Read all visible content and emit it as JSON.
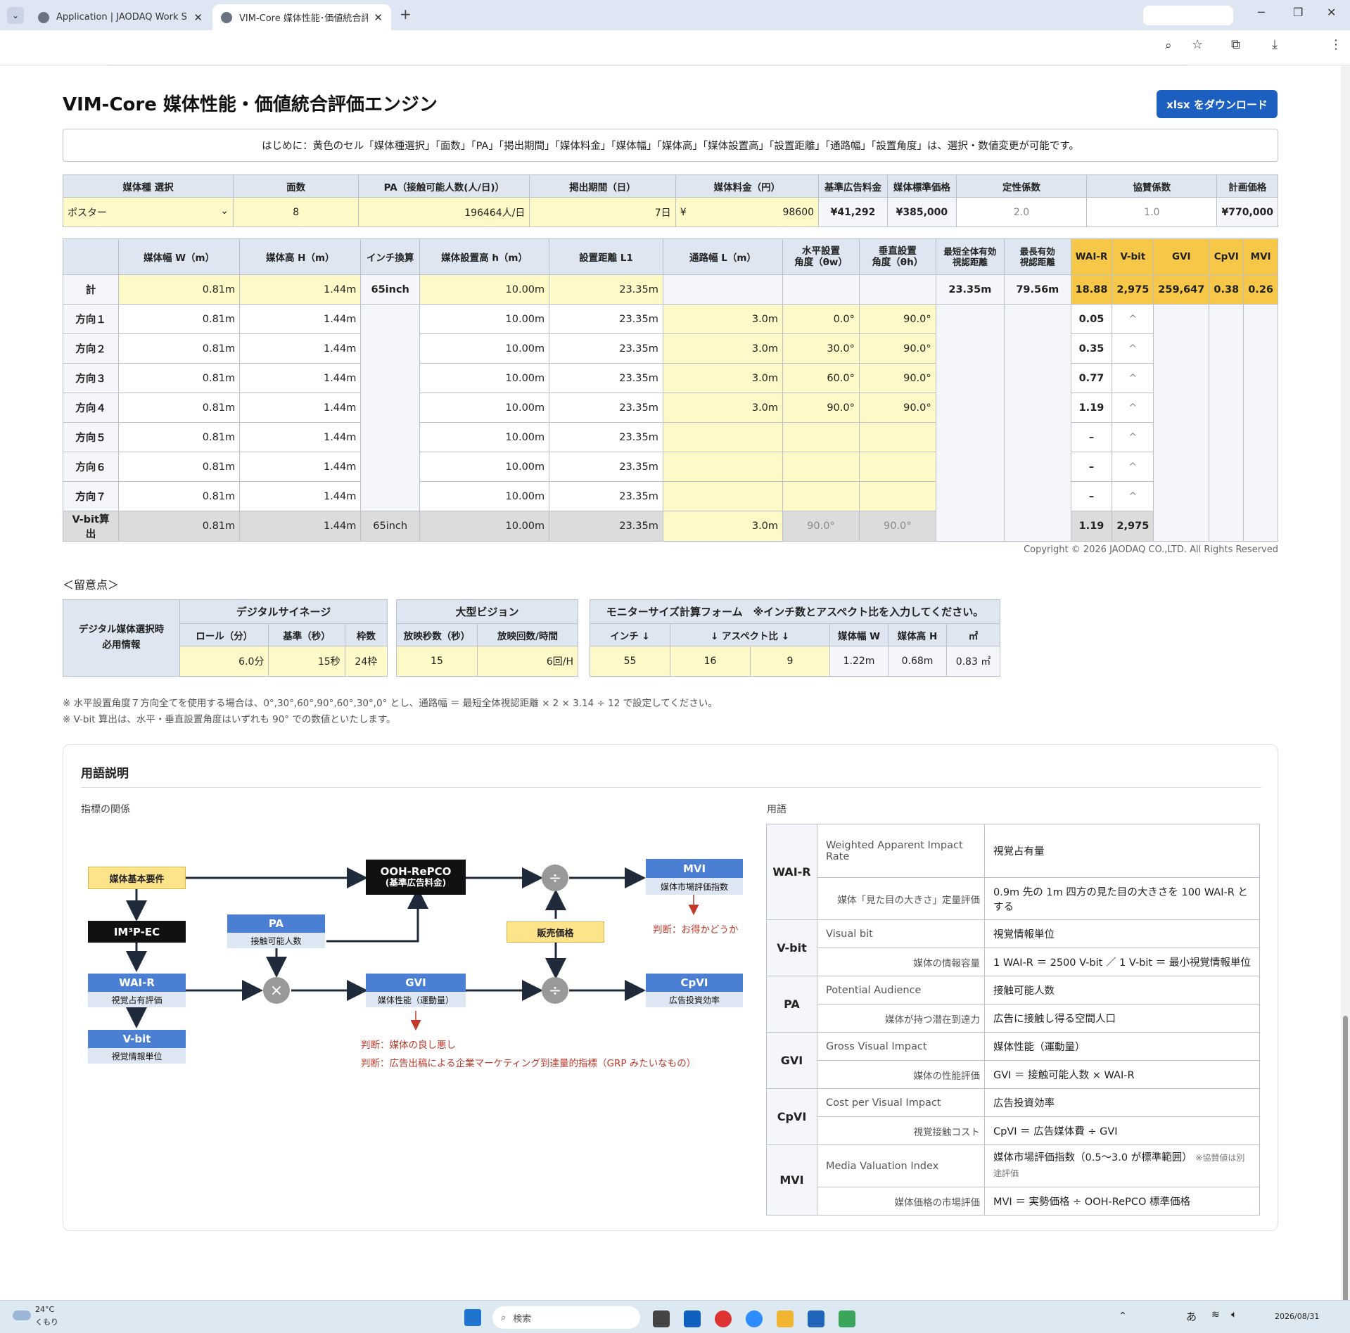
{
  "browser": {
    "tabs": [
      {
        "title": "Application | JAODAQ Work Space",
        "active": false
      },
      {
        "title": "VIM-Core 媒体性能･価値統合評価",
        "active": true
      }
    ],
    "new_tab": "+"
  },
  "page": {
    "title": "VIM-Core 媒体性能・価値統合評価エンジン",
    "download_label": "xlsx をダウンロード",
    "intro": "はじめに：黄色のセル「媒体種選択」「面数」「PA」「掲出期間」「媒体料金」「媒体幅」「媒体高」「媒体設置高」「設置距離」「通路幅」「設置角度」は、選択・数値変更が可能です。"
  },
  "top_table": {
    "headers": [
      "媒体種 選択",
      "面数",
      "PA（接触可能人数(人/日)）",
      "掲出期間（日）",
      "媒体料金（円）",
      "基準広告料金",
      "媒体標準価格",
      "定性係数",
      "協賛係数",
      "計画価格"
    ],
    "media_type": "ポスター",
    "faces": "8",
    "pa": "196464人/日",
    "period": "7日",
    "fee_currency": "¥",
    "fee": "98600",
    "base_fee": "¥41,292",
    "std_price": "¥385,000",
    "qual_coef": "2.0",
    "sponsor_coef": "1.0",
    "plan_price": "¥770,000"
  },
  "main_table": {
    "headers": [
      "",
      "媒体幅 W（m）",
      "媒体高 H（m）",
      "インチ換算",
      "媒体設置高 h（m）",
      "設置距離 L1",
      "通路幅 L（m）",
      "水平設置\n角度（θw）",
      "垂直設置\n角度（θh）",
      "最短全体有効\n視認距離",
      "最長有効\n視認距離",
      "WAI-R",
      "V-bit",
      "GVI",
      "CpVI",
      "MVI"
    ],
    "total": {
      "label": "計",
      "w": "0.81m",
      "h": "1.44m",
      "inch": "65inch",
      "ih": "10.00m",
      "dist": "23.35m",
      "min_dist": "23.35m",
      "max_dist": "79.56m",
      "wair": "18.88",
      "vbit": "2,975",
      "gvi": "259,647",
      "cpvi": "0.38",
      "mvi": "0.26"
    },
    "rows": [
      {
        "label": "方向１",
        "w": "0.81m",
        "h": "1.44m",
        "ih": "10.00m",
        "dist": "23.35m",
        "aisle": "3.0m",
        "tw": "0.0°",
        "th": "90.0°",
        "wair": "0.05",
        "vbit": "^"
      },
      {
        "label": "方向２",
        "w": "0.81m",
        "h": "1.44m",
        "ih": "10.00m",
        "dist": "23.35m",
        "aisle": "3.0m",
        "tw": "30.0°",
        "th": "90.0°",
        "wair": "0.35",
        "vbit": "^"
      },
      {
        "label": "方向３",
        "w": "0.81m",
        "h": "1.44m",
        "ih": "10.00m",
        "dist": "23.35m",
        "aisle": "3.0m",
        "tw": "60.0°",
        "th": "90.0°",
        "wair": "0.77",
        "vbit": "^"
      },
      {
        "label": "方向４",
        "w": "0.81m",
        "h": "1.44m",
        "ih": "10.00m",
        "dist": "23.35m",
        "aisle": "3.0m",
        "tw": "90.0°",
        "th": "90.0°",
        "wair": "1.19",
        "vbit": "^"
      },
      {
        "label": "方向５",
        "w": "0.81m",
        "h": "1.44m",
        "ih": "10.00m",
        "dist": "23.35m",
        "aisle": "",
        "tw": "",
        "th": "",
        "wair": "–",
        "vbit": "^"
      },
      {
        "label": "方向６",
        "w": "0.81m",
        "h": "1.44m",
        "ih": "10.00m",
        "dist": "23.35m",
        "aisle": "",
        "tw": "",
        "th": "",
        "wair": "–",
        "vbit": "^"
      },
      {
        "label": "方向７",
        "w": "0.81m",
        "h": "1.44m",
        "ih": "10.00m",
        "dist": "23.35m",
        "aisle": "",
        "tw": "",
        "th": "",
        "wair": "–",
        "vbit": "^"
      }
    ],
    "vbit_row": {
      "label": "V-bit算出",
      "w": "0.81m",
      "h": "1.44m",
      "inch": "65inch",
      "ih": "10.00m",
      "dist": "23.35m",
      "aisle": "3.0m",
      "tw": "90.0°",
      "th": "90.0°",
      "wair": "1.19",
      "vbit": "2,975"
    }
  },
  "copyright": "Copyright © 2026 JAODAQ CO.,LTD. All Rights Reserved",
  "notes": {
    "heading": "＜留意点＞",
    "digital_label": "デジタル媒体選択時\n必用情報",
    "signage": {
      "title": "デジタルサイネージ",
      "headers": [
        "ロール（分）",
        "基準（秒）",
        "枠数"
      ],
      "values": [
        "6.0分",
        "15秒",
        "24枠"
      ]
    },
    "vision": {
      "title": "大型ビジョン",
      "headers": [
        "放映秒数（秒）",
        "放映回数/時間"
      ],
      "values": [
        "15",
        "6回/H"
      ]
    },
    "monitor": {
      "title": "モニターサイズ計算フォーム　※インチ数とアスペクト比を入力してください。",
      "headers": [
        "インチ ↓",
        "↓ アスペクト比 ↓",
        "媒体幅 W",
        "媒体高 H",
        "㎡"
      ],
      "values": [
        "55",
        "16",
        "9",
        "1.22m",
        "0.68m",
        "0.83 ㎡"
      ]
    },
    "footnote1": "※ 水平設置角度７方向全てを使用する場合は、0°,30°,60°,90°,60°,30°,0° とし、通路幅 ＝ 最短全体視認距離 × 2 × 3.14 ÷ 12 で設定してください。",
    "footnote2": "※ V-bit 算出は、水平・垂直設置角度はいずれも 90° での数値といたします。"
  },
  "glossary": {
    "title": "用語説明",
    "left_title": "指標の関係",
    "right_title": "用語",
    "diagram": {
      "base": "媒体基本要件",
      "impec": "IM³P-EC",
      "wair": "WAI-R",
      "wair_sub": "視覚占有評価",
      "vbit": "V-bit",
      "vbit_sub": "視覚情報単位",
      "pa": "PA",
      "pa_sub": "接触可能人数",
      "ooh": "OOH-RePCO",
      "ooh_sub": "(基準広告料金)",
      "gvi": "GVI",
      "gvi_sub": "媒体性能（運動量）",
      "price": "販売価格",
      "mvi": "MVI",
      "mvi_sub": "媒体市場評価指数",
      "cpvi": "CpVI",
      "cpvi_sub": "広告投資効率",
      "times": "×",
      "div1": "÷",
      "div2": "÷",
      "judge_mvi": "判断：お得かどうか",
      "judge_gvi1": "判断：媒体の良し悪し",
      "judge_gvi2": "判断：広告出稿による企業マーケティング到達量的指標（GRP みたいなもの）"
    },
    "terms": [
      {
        "abbr": "WAI-R",
        "en": "Weighted Apparent Impact Rate",
        "jp": "視覚占有量",
        "desc_label": "媒体「見た目の大きさ」定量評価",
        "desc": "0.9m 先の 1m 四方の見た目の大きさを 100 WAI-R とする"
      },
      {
        "abbr": "V-bit",
        "en": "Visual bit",
        "jp": "視覚情報単位",
        "desc_label": "媒体の情報容量",
        "desc": "1 WAI-R ＝ 2500 V-bit ／ 1 V-bit ＝ 最小視覚情報単位"
      },
      {
        "abbr": "PA",
        "en": "Potential Audience",
        "jp": "接触可能人数",
        "desc_label": "媒体が持つ潜在到達力",
        "desc": "広告に接触し得る空間人口"
      },
      {
        "abbr": "GVI",
        "en": "Gross Visual Impact",
        "jp": "媒体性能（運動量）",
        "desc_label": "媒体の性能評価",
        "desc": "GVI ＝ 接触可能人数 × WAI-R"
      },
      {
        "abbr": "CpVI",
        "en": "Cost per Visual Impact",
        "jp": "広告投資効率",
        "desc_label": "視覚接触コスト",
        "desc": "CpVI ＝ 広告媒体費 ÷ GVI"
      },
      {
        "abbr": "MVI",
        "en": "Media Valuation Index",
        "jp": "媒体市場評価指数（0.5〜3.0 が標準範囲）",
        "jp_note": "※協賛値は別途評価",
        "desc_label": "媒体価格の市場評価",
        "desc": "MVI ＝ 実勢価格 ÷ OOH-RePCO 標準価格"
      }
    ]
  },
  "taskbar": {
    "temp": "24°C",
    "weather": "くもり",
    "search": "検索",
    "ime": "あ",
    "date": "2026/08/31"
  }
}
